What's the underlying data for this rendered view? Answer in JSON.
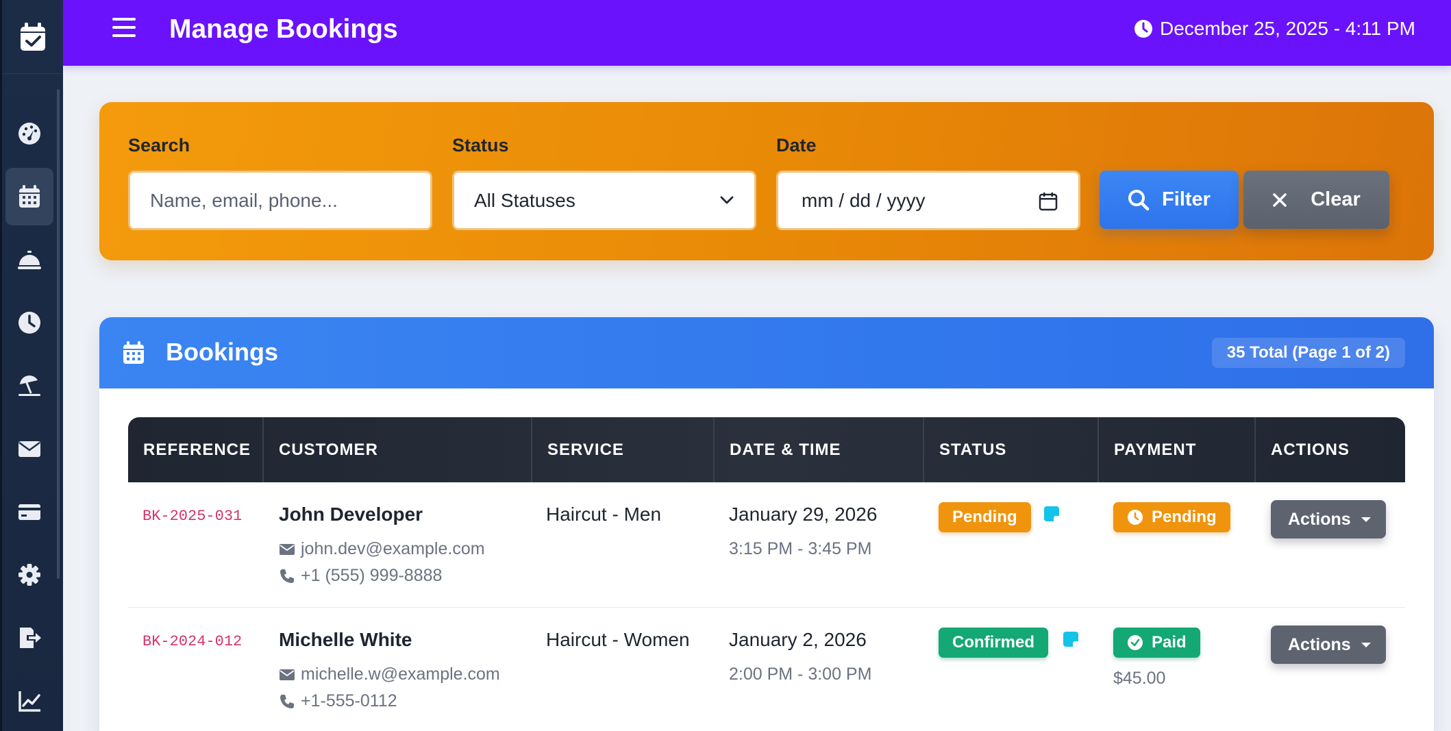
{
  "header": {
    "title": "Manage Bookings",
    "datetime": "December 25, 2025 - 4:11 PM"
  },
  "sidebar": {
    "items": [
      {
        "icon": "dashboard-gauge-icon",
        "active": false
      },
      {
        "icon": "calendar-icon",
        "active": true
      },
      {
        "icon": "concierge-bell-icon",
        "active": false
      },
      {
        "icon": "clock-icon",
        "active": false
      },
      {
        "icon": "beach-umbrella-icon",
        "active": false
      },
      {
        "icon": "envelope-icon",
        "active": false
      },
      {
        "icon": "credit-card-icon",
        "active": false
      },
      {
        "icon": "gear-icon",
        "active": false
      },
      {
        "icon": "logout-icon",
        "active": false
      },
      {
        "icon": "chart-line-icon",
        "active": false
      }
    ]
  },
  "filters": {
    "search_label": "Search",
    "search_placeholder": "Name, email, phone...",
    "status_label": "Status",
    "status_value": "All Statuses",
    "date_label": "Date",
    "date_placeholder": "mm / dd / yyyy",
    "filter_button": "Filter",
    "clear_button": "Clear"
  },
  "bookings": {
    "title": "Bookings",
    "count": "35 Total (Page 1 of 2)",
    "columns": [
      "REFERENCE",
      "CUSTOMER",
      "SERVICE",
      "DATE & TIME",
      "STATUS",
      "PAYMENT",
      "ACTIONS"
    ],
    "rows": [
      {
        "reference": "BK-2025-031",
        "customer": "John Developer",
        "email": "john.dev@example.com",
        "phone": "+1 (555) 999-8888",
        "service": "Haircut - Men",
        "date": "January 29, 2026",
        "time": "3:15 PM - 3:45 PM",
        "status": "Pending",
        "payment": "Pending",
        "amount": "",
        "action": "Actions"
      },
      {
        "reference": "BK-2024-012",
        "customer": "Michelle White",
        "email": "michelle.w@example.com",
        "phone": "+1-555-0112",
        "service": "Haircut - Women",
        "date": "January 2, 2026",
        "time": "2:00 PM - 3:00 PM",
        "status": "Confirmed",
        "payment": "Paid",
        "amount": "$45.00",
        "action": "Actions"
      }
    ]
  },
  "colors": {
    "header_bg": "#6a12fb",
    "filter_bg": "#f49b0c",
    "bookings_header_bg": "#3a85f2",
    "pending": "#f0940d",
    "confirmed": "#13a874",
    "reference_text": "#d6336c"
  }
}
